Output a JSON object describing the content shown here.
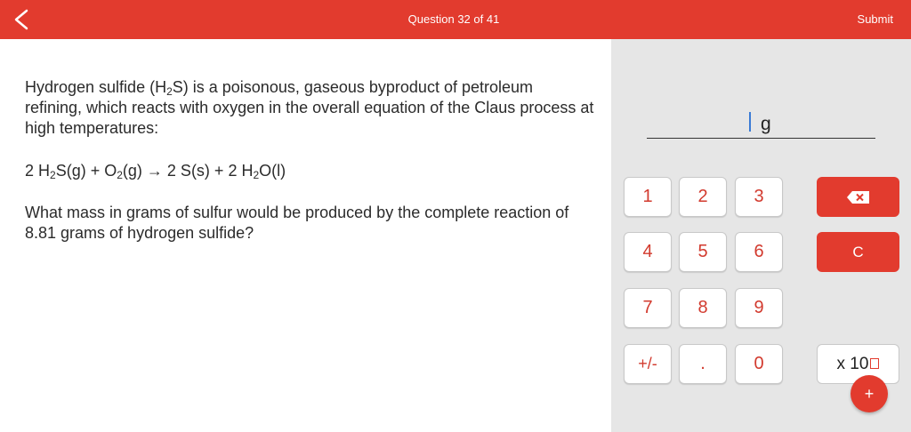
{
  "header": {
    "back_icon": "chevron-left-icon",
    "question_counter": "Question 32 of 41",
    "submit_label": "Submit",
    "color": "#e23b2e"
  },
  "question": {
    "intro_parts": [
      "Hydrogen sulfide (H",
      "2",
      "S) is a poisonous, gaseous byproduct of petroleum refining, which reacts with oxygen in the overall equation of the Claus process at high temperatures:"
    ],
    "equation_parts": [
      "2 H",
      "2",
      "S(g) + O",
      "2",
      "(g) → 2 S(s) + 2 H",
      "2",
      "O(l)"
    ],
    "prompt": "What mass in grams of sulfur would be produced by the complete reaction of 8.81 grams of hydrogen sulfide?"
  },
  "answer": {
    "value": "",
    "unit": "g"
  },
  "keypad": {
    "digits": [
      "1",
      "2",
      "3",
      "4",
      "5",
      "6",
      "7",
      "8",
      "9",
      "+/-",
      ".",
      "0"
    ],
    "backspace_icon": "backspace-icon",
    "clear_label": "C",
    "sci_label": "x 10",
    "plus_label": "+"
  }
}
